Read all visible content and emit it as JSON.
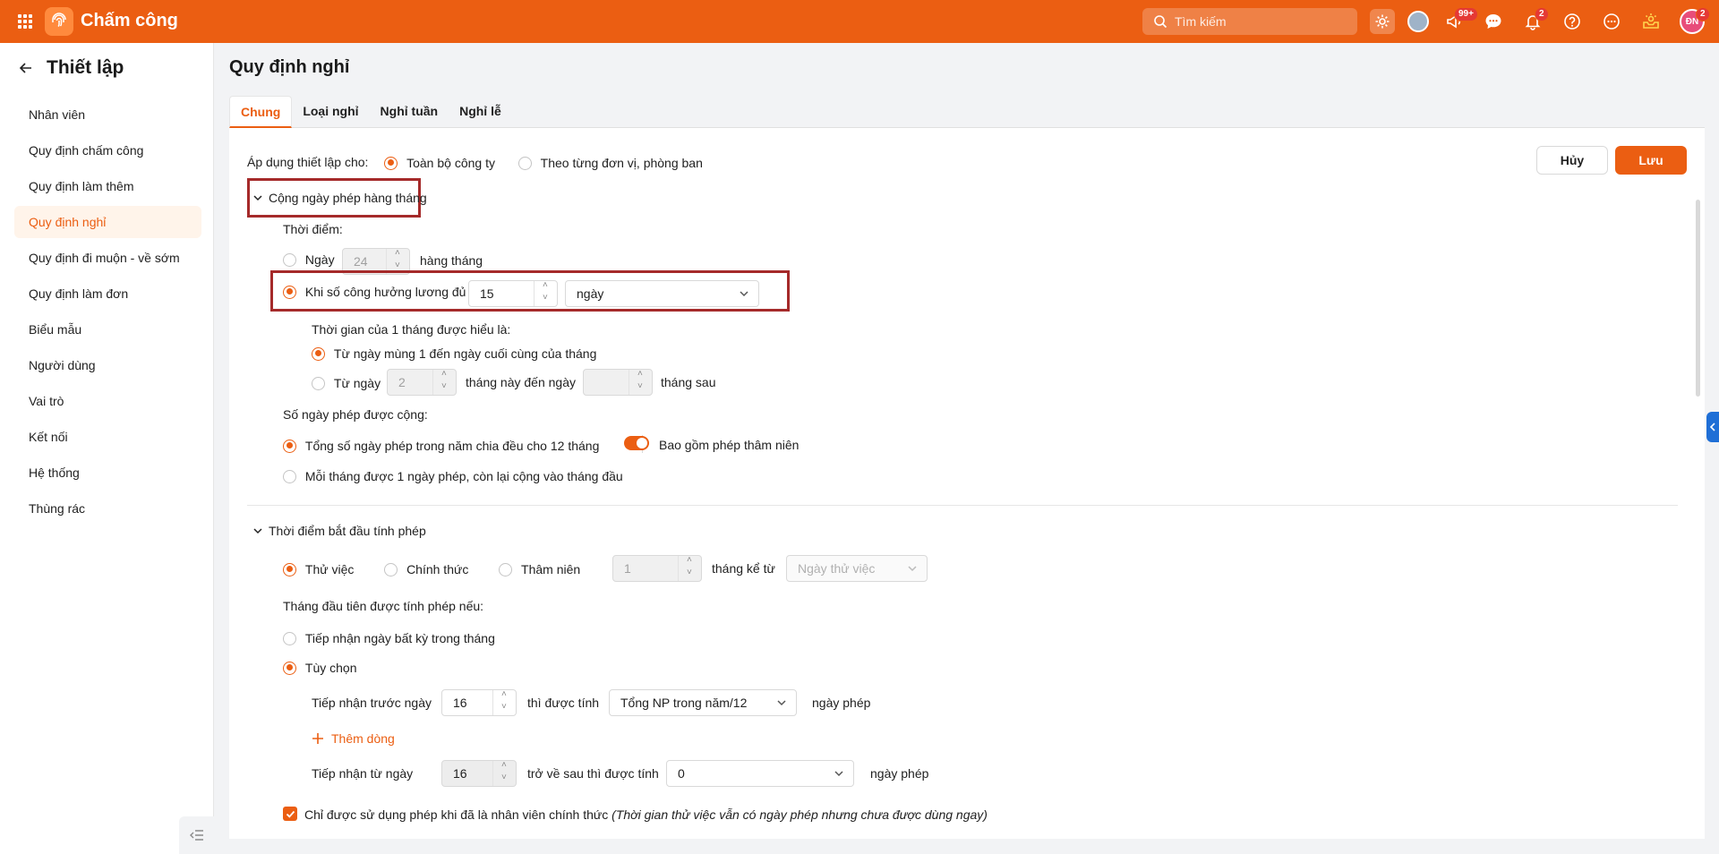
{
  "topbar": {
    "app_title": "Chấm công",
    "search_placeholder": "Tìm kiếm",
    "badge_updates": "99+",
    "badge_notifications": "2",
    "badge_avatar": "2",
    "avatar_initials": "ĐN",
    "accent_color": "#eb5e12"
  },
  "sidebar": {
    "title": "Thiết lập",
    "items": [
      {
        "label": "Nhân viên"
      },
      {
        "label": "Quy định chấm công"
      },
      {
        "label": "Quy định làm thêm"
      },
      {
        "label": "Quy định nghỉ"
      },
      {
        "label": "Quy định đi muộn - về sớm"
      },
      {
        "label": "Quy định làm đơn"
      },
      {
        "label": "Biểu mẫu"
      },
      {
        "label": "Người dùng"
      },
      {
        "label": "Vai trò"
      },
      {
        "label": "Kết nối"
      },
      {
        "label": "Hệ thống"
      },
      {
        "label": "Thùng rác"
      }
    ],
    "active_index": 3
  },
  "page": {
    "title": "Quy định nghỉ",
    "tabs": [
      {
        "label": "Chung"
      },
      {
        "label": "Loại nghỉ"
      },
      {
        "label": "Nghỉ tuần"
      },
      {
        "label": "Nghỉ lễ"
      }
    ],
    "active_tab": 0
  },
  "apply": {
    "label": "Áp dụng thiết lập cho:",
    "option_company": "Toàn bộ công ty",
    "option_units": "Theo từng đơn vị, phòng ban",
    "selected": "company"
  },
  "actions": {
    "cancel": "Hủy",
    "save": "Lưu"
  },
  "monthly": {
    "section_title": "Cộng ngày phép hàng tháng",
    "timing_label": "Thời điểm:",
    "opt_day_label": "Ngày",
    "opt_day_value": "24",
    "opt_day_suffix": "hàng tháng",
    "opt_enough_label": "Khi số công hưởng lương đủ",
    "opt_enough_value": "15",
    "opt_enough_unit": "ngày",
    "month_def_label": "Thời gian của 1 tháng được hiểu là:",
    "month_opt1": "Từ ngày mùng 1 đến ngày cuối cùng của tháng",
    "month_opt2_prefix": "Từ ngày",
    "month_opt2_value": "2",
    "month_opt2_mid": "tháng này đến ngày",
    "month_opt2_value2": "",
    "month_opt2_suffix": "tháng sau",
    "days_added_label": "Số ngày phép được cộng:",
    "days_opt1": "Tổng số ngày phép trong năm chia đều cho 12 tháng",
    "include_seniority": "Bao gồm phép thâm niên",
    "include_seniority_on": true,
    "days_opt2": "Mỗi tháng được 1 ngày phép, còn lại cộng vào tháng đầu"
  },
  "start": {
    "section_title": "Thời điểm bắt đầu tính phép",
    "opt_probation": "Thử việc",
    "opt_official": "Chính thức",
    "opt_seniority": "Thâm niên",
    "months_value": "1",
    "months_suffix": "tháng kể từ",
    "from_select": "Ngày thử việc",
    "first_month_label": "Tháng đầu tiên được tính phép nếu:",
    "fm_opt1": "Tiếp nhận ngày bất kỳ trong tháng",
    "fm_opt2": "Tùy chọn",
    "row1_prefix": "Tiếp nhận trước ngày",
    "row1_value": "16",
    "row1_mid": "thì được tính",
    "row1_select": "Tổng NP trong năm/12",
    "row1_suffix": "ngày phép",
    "add_row": "Thêm dòng",
    "row2_prefix": "Tiếp nhận từ ngày",
    "row2_value": "16",
    "row2_mid": "trở về sau thì được tính",
    "row2_select": "0",
    "row2_suffix": "ngày phép",
    "official_only": "Chỉ được sử dụng phép khi đã là nhân viên chính thức",
    "official_only_note": "(Thời gian thử việc vẫn có ngày phép nhưng chưa được dùng ngay)"
  }
}
